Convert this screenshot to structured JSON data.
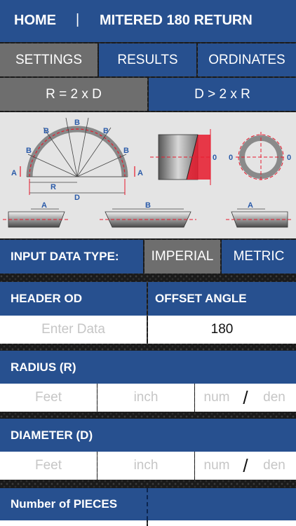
{
  "header": {
    "home": "HOME",
    "separator": "|",
    "title": "MITERED 180 RETURN"
  },
  "tabs": [
    {
      "label": "SETTINGS",
      "selected": true
    },
    {
      "label": "RESULTS",
      "selected": false
    },
    {
      "label": "ORDINATES",
      "selected": false
    }
  ],
  "modes": [
    {
      "label": "R = 2 x D",
      "selected": true
    },
    {
      "label": "D > 2 x R",
      "selected": false
    }
  ],
  "diagram": {
    "segment_labels": [
      "B",
      "B",
      "B",
      "B",
      "B"
    ],
    "end_label": "A",
    "radius_label": "R",
    "diameter_label": "D",
    "zero_label": "0",
    "pipe_labels": [
      "A",
      "B",
      "A"
    ]
  },
  "input_type": {
    "label": "INPUT DATA TYPE:",
    "options": [
      {
        "label": "IMPERIAL",
        "selected": true
      },
      {
        "label": "METRIC",
        "selected": false
      }
    ]
  },
  "header_od": {
    "label": "HEADER OD",
    "placeholder": "Enter Data"
  },
  "offset_angle": {
    "label": "OFFSET ANGLE",
    "value": "180"
  },
  "radius": {
    "label": "RADIUS (R)",
    "feet_placeholder": "Feet",
    "inch_placeholder": "inch",
    "num_placeholder": "num",
    "slash": "/",
    "den_placeholder": "den"
  },
  "diameter": {
    "label": "DIAMETER (D)",
    "feet_placeholder": "Feet",
    "inch_placeholder": "inch",
    "num_placeholder": "num",
    "slash": "/",
    "den_placeholder": "den"
  },
  "pieces": {
    "label": "Number of PIECES"
  },
  "colors": {
    "blue": "#27508f",
    "selected_gray": "#6e6e6e",
    "diagram_red": "#e8192c",
    "diagram_blue": "#2a5aa8"
  }
}
